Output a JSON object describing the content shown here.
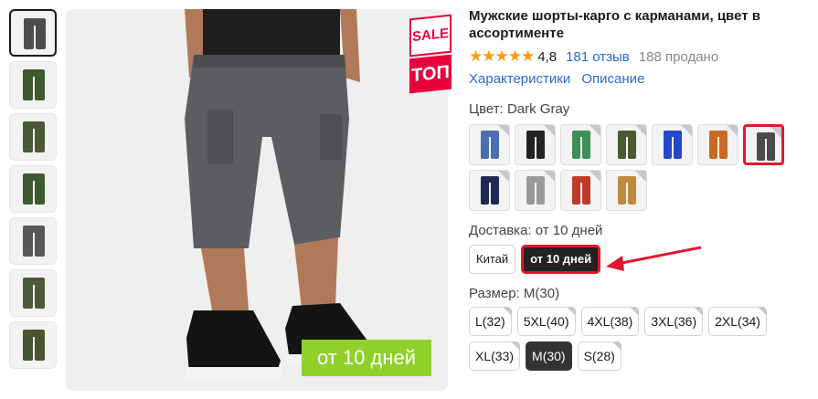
{
  "product": {
    "title": "Мужские шорты-карго с карманами, цвет в ассортименте",
    "stars": "★★★★★",
    "rating": "4,8",
    "reviews": "181 отзыв",
    "sold": "188 продано",
    "tab_links": [
      "Характеристики",
      "Описание"
    ]
  },
  "gallery": {
    "badge_top": "SALE",
    "badge_bottom": "ТОП",
    "delivery_banner": "от 10 дней",
    "thumb_colors": [
      "#4d4d4d",
      "#3d5a2c",
      "#4a5a35",
      "#3f5a30",
      "#585858",
      "#4c5a3a",
      "#48552f"
    ]
  },
  "color": {
    "label": "Цвет: Dark Gray",
    "swatches": [
      {
        "name": "blue",
        "hex": "#4a6fb0"
      },
      {
        "name": "black",
        "hex": "#222222"
      },
      {
        "name": "green",
        "hex": "#3d8f54"
      },
      {
        "name": "olive",
        "hex": "#4a5a2c"
      },
      {
        "name": "royal-blue",
        "hex": "#2348c8"
      },
      {
        "name": "orange",
        "hex": "#c96a22"
      },
      {
        "name": "dark-gray",
        "hex": "#4b4b4b"
      },
      {
        "name": "navy",
        "hex": "#1d2a55"
      },
      {
        "name": "light-gray",
        "hex": "#9a9a9a"
      },
      {
        "name": "red",
        "hex": "#c0392b"
      },
      {
        "name": "khaki",
        "hex": "#c08a3e"
      }
    ],
    "selected_index": 6
  },
  "delivery": {
    "label": "Доставка: от 10 дней",
    "options": [
      "Китай",
      "от 10 дней"
    ],
    "selected_index": 1,
    "highlight_color": "#e3172c"
  },
  "size": {
    "label": "Размер: M(30)",
    "options": [
      "L(32)",
      "5XL(40)",
      "4XL(38)",
      "3XL(36)",
      "2XL(34)",
      "XL(33)",
      "M(30)",
      "S(28)"
    ],
    "selected_index": 6
  }
}
